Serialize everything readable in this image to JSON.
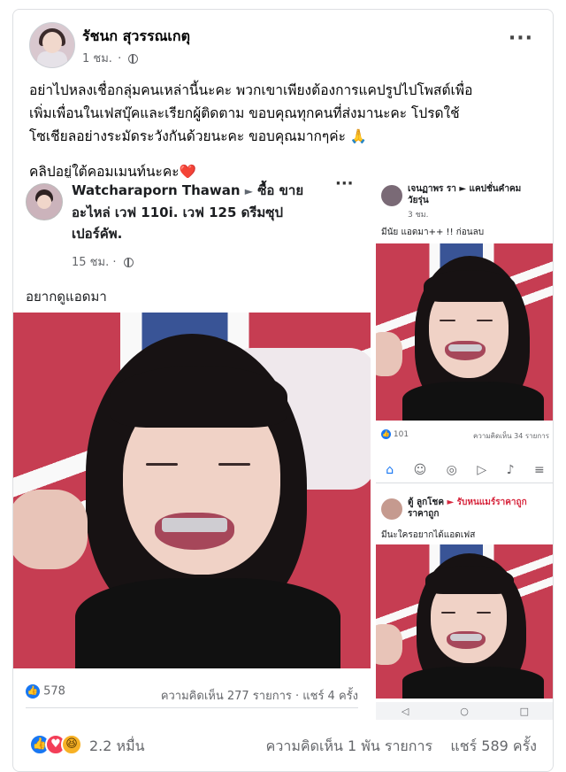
{
  "post": {
    "author": "รัชนก สุวรรณเกตุ",
    "time": "1 ชม.",
    "caption_line1": "อย่าไปหลงเชื่อกลุ่มคนเหล่านี้นะคะ พวกเขาเพียงต้องการแคปรูปไปโพสต์เพื่อ",
    "caption_line2": "เพิ่มเพื่อนในเฟสบุ๊คและเรียกผู้ติดตาม ขอบคุณทุกคนที่ส่งมานะคะ โปรดใช้",
    "caption_line3": "โซเชียลอย่างระมัดระวังกันด้วยนะคะ ขอบคุณมากๆค่ะ",
    "caption_pray": "🙏",
    "clip_note": "คลิปอยู่ใต้คอมเมนท์นะคะ",
    "clip_heart": "❤️",
    "reaction_count": "2.2 หมื่น",
    "comments": "ความคิดเห็น 1 พัน รายการ",
    "shares": "แชร์ 589 ครั้ง",
    "more_icon": "···"
  },
  "left_screenshot": {
    "name": "Watcharaporn Thawan",
    "arrow": "►",
    "group_line1": "ซื้อ ขาย",
    "group_line2": "อะไหล่ เวฟ 110i. เวฟ 125 ดรีมซุป",
    "group_line3": "เปอร์คัพ.",
    "time": "15 ชม.",
    "caption": "อยากดูแอดมา",
    "likes": "578",
    "comments_shares": "ความคิดเห็น 277 รายการ · แชร์ 4 ครั้ง"
  },
  "top_right_screenshot": {
    "name": "เจนฏาพร รา",
    "group": "► แคปชั่นคำคม",
    "group2": "วัยรุ่น",
    "time": "3 ชม.",
    "caption": "มีนัย แอดมา++ !! ก่อนลบ",
    "likes": "101",
    "comments": "ความคิดเห็น 34 รายการ"
  },
  "bottom_right_screenshot": {
    "name": "ตู้ ลูกโชค",
    "group": "► รับหนแมร์ราคาถูก",
    "group2": "ราคาถูก",
    "caption": "มีนะใครอยากได้แอดเฟส"
  },
  "icons": [
    "globe-icon",
    "like-icon",
    "love-icon",
    "haha-icon",
    "more-icon"
  ],
  "colors": {
    "facebook_blue": "#1877f2",
    "love_red": "#f33e58",
    "haha_yellow": "#f7b125",
    "meta_gray": "#65676b"
  }
}
